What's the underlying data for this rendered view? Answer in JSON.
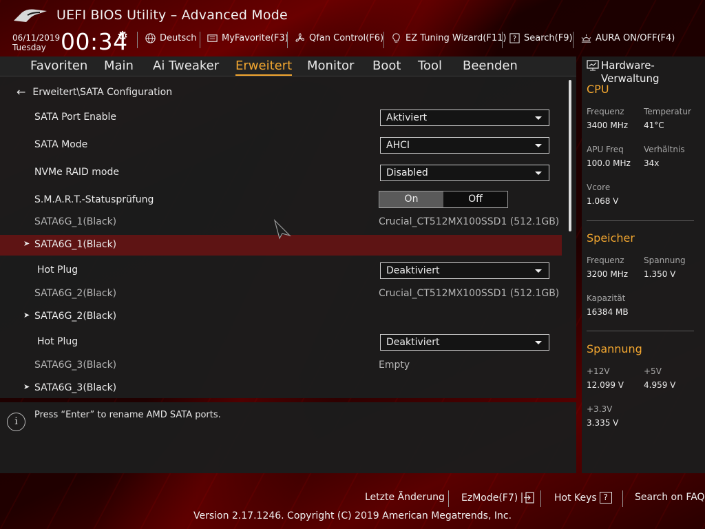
{
  "window": {
    "title": "UEFI BIOS Utility – Advanced Mode"
  },
  "status": {
    "date": "06/11/2019",
    "weekday": "Tuesday",
    "time": "00:34"
  },
  "toolbar": {
    "language": "Deutsch",
    "my_favorite": "MyFavorite(F3)",
    "qfan": "Qfan Control(F6)",
    "ez_tuning": "EZ Tuning Wizard(F11)",
    "search": "Search(F9)",
    "aura": "AURA ON/OFF(F4)"
  },
  "tabs": [
    "Favoriten",
    "Main",
    "Ai Tweaker",
    "Erweitert",
    "Monitor",
    "Boot",
    "Tool",
    "Beenden"
  ],
  "active_tab": "Erweitert",
  "breadcrumb": "Erweitert\\SATA Configuration",
  "settings": {
    "sata_port_enable": {
      "label": "SATA Port Enable",
      "value": "Aktiviert"
    },
    "sata_mode": {
      "label": "SATA Mode",
      "value": "AHCI"
    },
    "nvme_raid": {
      "label": "NVMe RAID mode",
      "value": "Disabled"
    },
    "smart": {
      "label": "S.M.A.R.T.-Statusprüfung",
      "on": "On",
      "off": "Off",
      "selected": "On"
    },
    "port1_info": {
      "label": "SATA6G_1(Black)",
      "value": "Crucial_CT512MX100SSD1 (512.1GB)"
    },
    "port1_menu": {
      "label": "SATA6G_1(Black)"
    },
    "port1_hotplug": {
      "label": "Hot Plug",
      "value": "Deaktiviert"
    },
    "port2_info": {
      "label": "SATA6G_2(Black)",
      "value": "Crucial_CT512MX100SSD1 (512.1GB)"
    },
    "port2_menu": {
      "label": "SATA6G_2(Black)"
    },
    "port2_hotplug": {
      "label": "Hot Plug",
      "value": "Deaktiviert"
    },
    "port3_info": {
      "label": "SATA6G_3(Black)",
      "value": "Empty"
    },
    "port3_menu": {
      "label": "SATA6G_3(Black)"
    }
  },
  "description": "Press “Enter” to rename AMD SATA ports.",
  "hardware": {
    "title": "Hardware-Verwaltung",
    "cpu": {
      "title": "CPU",
      "freq_label": "Frequenz",
      "freq": "3400 MHz",
      "temp_label": "Temperatur",
      "temp": "41°C",
      "apu_label": "APU Freq",
      "apu": "100.0 MHz",
      "ratio_label": "Verhältnis",
      "ratio": "34x",
      "vcore_label": "Vcore",
      "vcore": "1.068 V"
    },
    "memory": {
      "title": "Speicher",
      "freq_label": "Frequenz",
      "freq": "3200 MHz",
      "volt_label": "Spannung",
      "volt": "1.350 V",
      "cap_label": "Kapazität",
      "cap": "16384 MB"
    },
    "voltage": {
      "title": "Spannung",
      "v12_label": "+12V",
      "v12": "12.099 V",
      "v5_label": "+5V",
      "v5": "4.959 V",
      "v33_label": "+3.3V",
      "v33": "3.335 V"
    }
  },
  "footer": {
    "last_change": "Letzte Änderung",
    "ezmode": "EzMode(F7)",
    "hotkeys": "Hot Keys",
    "hotkeys_key": "?",
    "faq": "Search on FAQ",
    "copyright": "Version 2.17.1246. Copyright (C) 2019 American Megatrends, Inc."
  },
  "icons": {
    "logo": "rog-logo",
    "settings": "gear-icon",
    "language": "globe-icon",
    "favorite": "favorite-list-icon",
    "fan": "fan-icon",
    "tuning": "lightbulb-icon",
    "search": "search-help-icon",
    "aura": "aura-light-icon",
    "back": "back-arrow-icon",
    "info": "info-icon",
    "monitor": "monitor-icon",
    "ezmode": "exit-arrow-icon"
  },
  "colors": {
    "accent": "#f3a730",
    "highlight": "#5e1414",
    "brand_red": "#8a0000"
  }
}
